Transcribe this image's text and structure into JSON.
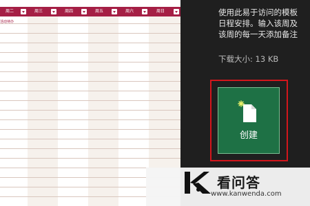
{
  "template_preview": {
    "header_color": "#a51f45",
    "days": [
      "周二",
      "周三",
      "周四",
      "周五",
      "周六",
      "周日"
    ],
    "first_row_note": "活动待办"
  },
  "template_info": {
    "description": [
      "使用此易于访问的模板",
      "日程安排。输入该周及",
      "该周的每一天添加备注"
    ],
    "download_size": "下载大小:  13 KB"
  },
  "create_button": {
    "label": "创建",
    "icon": "new-document-icon",
    "color": "#1e7145",
    "highlight_color": "#d4161c"
  },
  "watermark": {
    "name": "看问答",
    "url": "www.kanwenda.com"
  }
}
